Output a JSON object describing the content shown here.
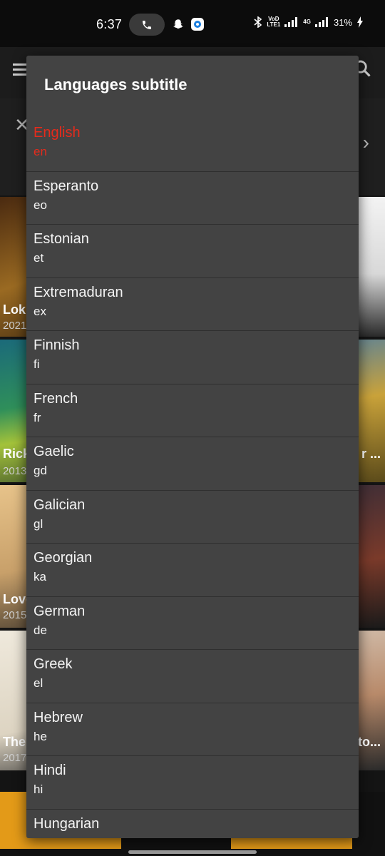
{
  "status_bar": {
    "time": "6:37",
    "volte_top": "VoD",
    "volte_bottom": "LTE1",
    "net_4g": "4G",
    "battery": "31%"
  },
  "background": {
    "posters": [
      {
        "title": "Loki",
        "year": "2021"
      },
      {
        "title": "Rick",
        "year": "2013"
      },
      {
        "title": "Love",
        "year": "2015"
      },
      {
        "title": "The",
        "year": "2017"
      },
      {
        "title": "r ...",
        "year": ""
      },
      {
        "title": "to...",
        "year": ""
      }
    ]
  },
  "dialog": {
    "title": "Languages subtitle",
    "languages": [
      {
        "name": "English",
        "code": "en",
        "selected": true
      },
      {
        "name": "Esperanto",
        "code": "eo"
      },
      {
        "name": "Estonian",
        "code": "et"
      },
      {
        "name": "Extremaduran",
        "code": "ex"
      },
      {
        "name": "Finnish",
        "code": "fi"
      },
      {
        "name": "French",
        "code": "fr"
      },
      {
        "name": "Gaelic",
        "code": "gd"
      },
      {
        "name": "Galician",
        "code": "gl"
      },
      {
        "name": "Georgian",
        "code": "ka"
      },
      {
        "name": "German",
        "code": "de"
      },
      {
        "name": "Greek",
        "code": "el"
      },
      {
        "name": "Hebrew",
        "code": "he"
      },
      {
        "name": "Hindi",
        "code": "hi"
      },
      {
        "name": "Hungarian",
        "code": "hu"
      }
    ]
  },
  "colors": {
    "selected": "#e52b1c",
    "dialog_bg": "#434343",
    "text": "#f4f4f4"
  }
}
